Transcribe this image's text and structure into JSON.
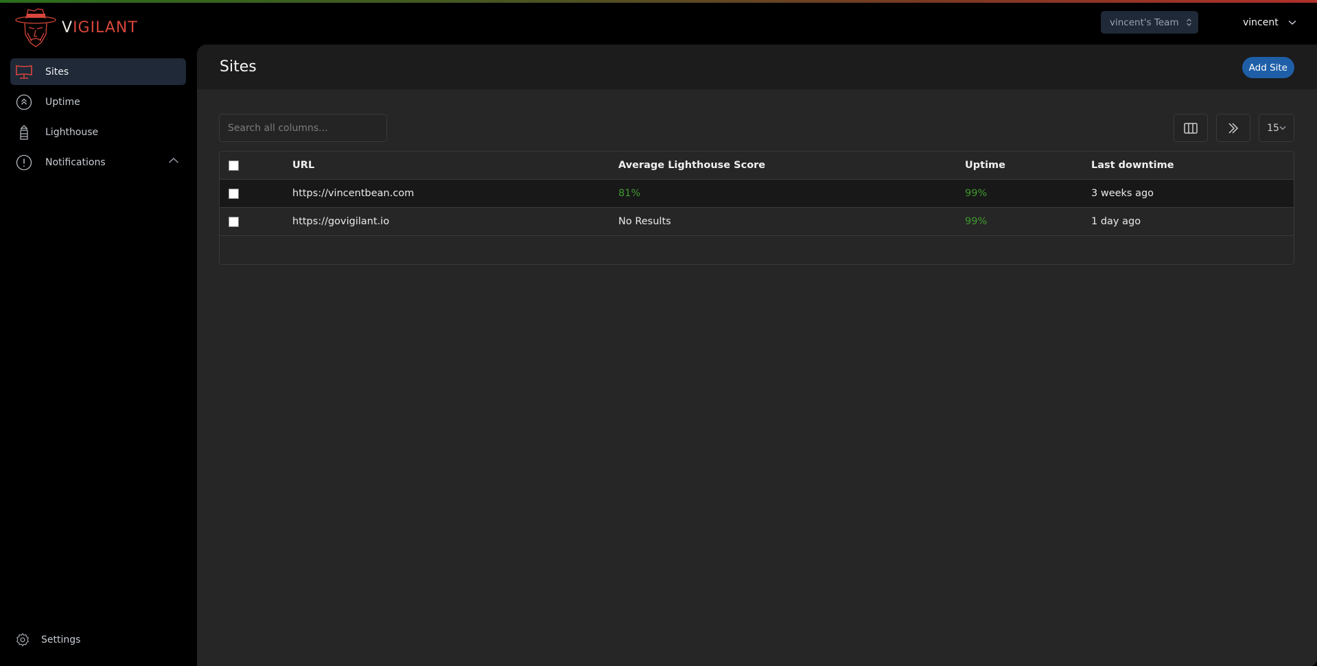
{
  "brand": {
    "logo_text_first": "V",
    "logo_text_rest": "IGILANT",
    "accent": "#d9463c"
  },
  "topbar": {
    "team_label": "vincent's Team",
    "user_label": "vincent"
  },
  "sidebar": {
    "items": [
      {
        "label": "Sites",
        "icon": "monitor-icon",
        "active": true
      },
      {
        "label": "Uptime",
        "icon": "chevrons-up-circle-icon",
        "active": false
      },
      {
        "label": "Lighthouse",
        "icon": "lighthouse-icon",
        "active": false
      },
      {
        "label": "Notifications",
        "icon": "alert-circle-icon",
        "active": false,
        "expanded": true
      }
    ],
    "footer": {
      "label": "Settings",
      "icon": "gear-icon"
    }
  },
  "main": {
    "title": "Sites",
    "add_button": "Add Site",
    "search": {
      "placeholder": "Search all columns...",
      "value": ""
    },
    "toolbar": {
      "columns_icon": "columns-icon",
      "next_icon": "chevrons-right-icon",
      "page_size": "15"
    },
    "table": {
      "columns": [
        "URL",
        "Average Lighthouse Score",
        "Uptime",
        "Last downtime"
      ],
      "rows": [
        {
          "url": "https://vincentbean.com",
          "score": "81%",
          "uptime": "99%",
          "last_downtime": "3 weeks ago",
          "score_good": true
        },
        {
          "url": "https://govigilant.io",
          "score": "No Results",
          "uptime": "99%",
          "last_downtime": "1 day ago",
          "score_good": false
        }
      ]
    },
    "colors": {
      "good": "#3f9a2f",
      "primary": "#1e5fa8"
    }
  }
}
